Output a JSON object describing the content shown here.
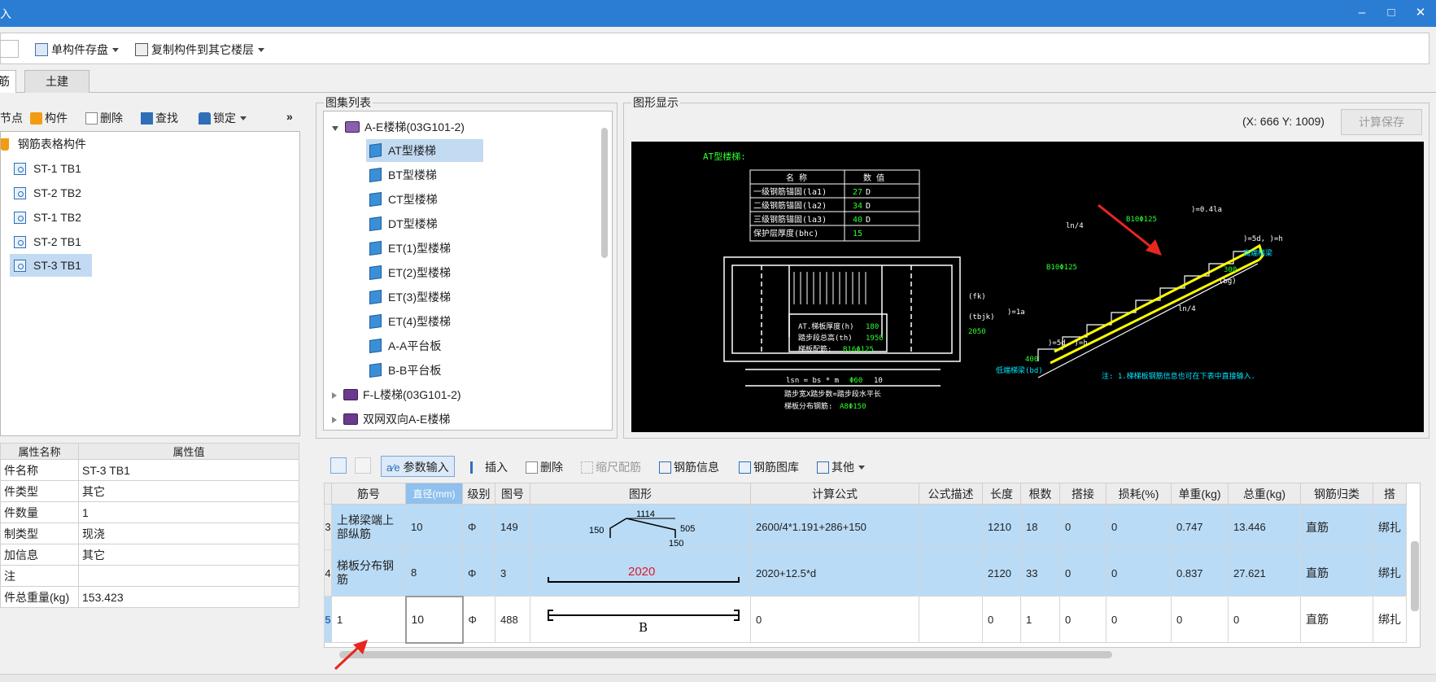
{
  "window": {
    "title": "入",
    "min": "–",
    "max": "□",
    "close": "✕"
  },
  "toolbar": {
    "save_single": "单构件存盘",
    "copy_to_floor": "复制构件到其它楼层"
  },
  "tabs": [
    {
      "label": "筋",
      "active": true
    },
    {
      "label": "土建",
      "active": false
    }
  ],
  "left_toolbar": {
    "node": "节点",
    "component": "构件",
    "delete": "删除",
    "find": "查找",
    "lock": "锁定",
    "more": "»"
  },
  "tree": {
    "root": "钢筋表格构件",
    "items": [
      "ST-1 TB1",
      "ST-2 TB2",
      "ST-1 TB2",
      "ST-2 TB1",
      "ST-3 TB1"
    ],
    "selected_index": 4
  },
  "props": {
    "header": {
      "name": "属性名称",
      "value": "属性值"
    },
    "rows": [
      {
        "name": "件名称",
        "value": "ST-3 TB1"
      },
      {
        "name": "件类型",
        "value": "其它"
      },
      {
        "name": "件数量",
        "value": "1"
      },
      {
        "name": "制类型",
        "value": "现浇"
      },
      {
        "name": "加信息",
        "value": "其它"
      },
      {
        "name": "注",
        "value": ""
      },
      {
        "name": "件总重量(kg)",
        "value": "153.423"
      }
    ]
  },
  "atlas": {
    "group_title": "图集列表",
    "groups": [
      {
        "label": "A-E楼梯(03G101-2)",
        "expanded": true
      },
      {
        "label": "F-L楼梯(03G101-2)",
        "expanded": false
      },
      {
        "label": "双网双向A-E楼梯",
        "expanded": false
      }
    ],
    "items": [
      "AT型楼梯",
      "BT型楼梯",
      "CT型楼梯",
      "DT型楼梯",
      "ET(1)型楼梯",
      "ET(2)型楼梯",
      "ET(3)型楼梯",
      "ET(4)型楼梯",
      "A-A平台板",
      "B-B平台板"
    ],
    "selected_index": 0
  },
  "graphic": {
    "group_title": "图形显示",
    "coords": "(X: 666 Y: 1009)",
    "calc_save": "计算保存",
    "cad": {
      "title": "AT型楼梯:",
      "table_headers": [
        "名   称",
        "数   值"
      ],
      "table_rows": [
        {
          "name": "一级钢筋锚固(la1)",
          "value": "27",
          "unit": "D"
        },
        {
          "name": "二级钢筋锚固(la2)",
          "value": "34",
          "unit": "D"
        },
        {
          "name": "三级钢筋锚固(la3)",
          "value": "40",
          "unit": "D"
        },
        {
          "name": "保护层厚度(bhc)",
          "value": "15",
          "unit": ""
        }
      ],
      "plan_text1": "AT.梯板厚度(h)",
      "plan_val1": "180",
      "plan_text2": "踏步段总高(th)",
      "plan_val2": "1950",
      "plan_text3": "梯板配筋:",
      "plan_val3": "B16Φ125",
      "fk": "(fk)",
      "tbjk": "(tbjk)",
      "tbjk_val": "2050",
      "lsn": "lsn = bs * m",
      "lsn_val1": "Φ60",
      "lsn_val2": "10",
      "note_line1": "踏步宽X踏步数=踏步段水平长",
      "note_line2": "梯板分布钢筋:",
      "note_val2": "A8Φ150",
      "top_bar": "B10Φ125",
      "mid_bar": "B10Φ125",
      "ln4_top": "ln/4",
      "ln4_bot": "ln/4",
      "dim_04": ")=0.4la",
      "dim_5d_top": ")=5d, )=h",
      "high_beam": "高端梯梁",
      "dim_300": "300",
      "dim_bg": "(bg)",
      "dim_1a": ")=1a",
      "dim_400": "400",
      "low_beam": "低端梯梁(bd)",
      "dim_5d_bot": ")=5d, )=h",
      "note": "注: 1.梯梯板钢筋信息也可在下表中直接输入."
    }
  },
  "bottom_toolbar": {
    "param_input": "参数输入",
    "insert": "插入",
    "delete": "删除",
    "scale_rebar": "缩尺配筋",
    "rebar_info": "钢筋信息",
    "rebar_lib": "钢筋图库",
    "other": "其他"
  },
  "grid": {
    "headers": [
      "筋号",
      "直径(mm)",
      "级别",
      "图号",
      "图形",
      "计算公式",
      "公式描述",
      "长度",
      "根数",
      "搭接",
      "损耗(%)",
      "单重(kg)",
      "总重(kg)",
      "钢筋归类",
      "搭"
    ],
    "rows": [
      {
        "no": "3",
        "name": "上梯梁端上部纵筋",
        "dia": "10",
        "grade": "Φ",
        "fig": "149",
        "shape_top": "1114",
        "shape_left": "150",
        "shape_right": "505",
        "shape_bottom": "150",
        "formula": "2600/4*1.191+286+150",
        "desc": "",
        "len": "1210",
        "count": "18",
        "lap": "0",
        "loss": "0",
        "unit_w": "0.747",
        "total_w": "13.446",
        "class": "直筋",
        "extra": "绑扎"
      },
      {
        "no": "4",
        "name": "梯板分布钢筋",
        "dia": "8",
        "grade": "Φ",
        "fig": "3",
        "shape_label": "2020",
        "formula": "2020+12.5*d",
        "desc": "",
        "len": "2120",
        "count": "33",
        "lap": "0",
        "loss": "0",
        "unit_w": "0.837",
        "total_w": "27.621",
        "class": "直筋",
        "extra": "绑扎"
      },
      {
        "no": "5",
        "name": "1",
        "dia": "10",
        "grade": "Φ",
        "fig": "488",
        "shape_label": "B",
        "formula": "0",
        "desc": "",
        "len": "0",
        "count": "1",
        "lap": "0",
        "loss": "0",
        "unit_w": "0",
        "total_w": "0",
        "class": "直筋",
        "extra": "绑扎"
      }
    ]
  },
  "colors": {
    "accent": "#2b7cd3",
    "selection": "#c3dbf2",
    "row_highlight": "#b9dbf6",
    "cad_green": "#2cff2c",
    "cad_yellow": "#ffff00",
    "cad_cyan": "#00e5ff",
    "arrow_red": "#e8261f"
  }
}
